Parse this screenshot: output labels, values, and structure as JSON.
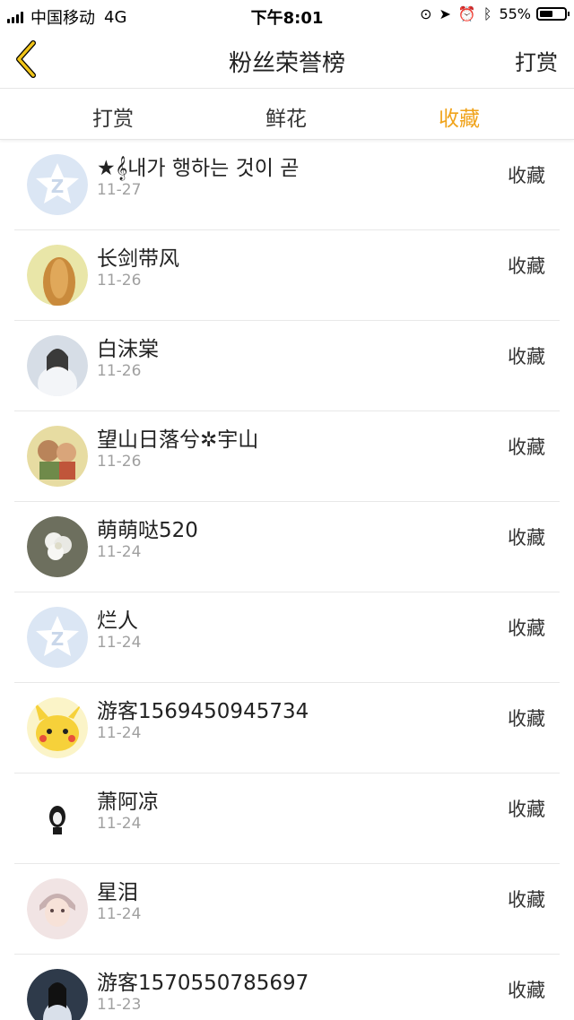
{
  "status_bar": {
    "carrier": "中国移动",
    "network": "4G",
    "time": "下午8:01",
    "battery": "55%",
    "battery_level": 0.55
  },
  "nav": {
    "title": "粉丝荣誉榜",
    "action": "打赏",
    "back_icon": "chevron-left-icon"
  },
  "tabs": [
    {
      "label": "打赏",
      "active": false
    },
    {
      "label": "鲜花",
      "active": false
    },
    {
      "label": "收藏",
      "active": true
    }
  ],
  "accent_color": "#f0a31b",
  "list": [
    {
      "name": "★𝄞내가 행하는 것이 곧",
      "date": "11-27",
      "action": "收藏",
      "avatar": "default-qq-avatar"
    },
    {
      "name": "长剑带风",
      "date": "11-26",
      "action": "收藏",
      "avatar": "photo-avatar"
    },
    {
      "name": "白沫棠",
      "date": "11-26",
      "action": "收藏",
      "avatar": "photo-avatar"
    },
    {
      "name": "望山日落兮✲宇山",
      "date": "11-26",
      "action": "收藏",
      "avatar": "cartoon-avatar"
    },
    {
      "name": "萌萌哒520",
      "date": "11-24",
      "action": "收藏",
      "avatar": "flower-avatar"
    },
    {
      "name": "烂人",
      "date": "11-24",
      "action": "收藏",
      "avatar": "default-qq-avatar"
    },
    {
      "name": "游客1569450945734",
      "date": "11-24",
      "action": "收藏",
      "avatar": "pikachu-avatar"
    },
    {
      "name": "萧阿凉",
      "date": "11-24",
      "action": "收藏",
      "avatar": "drawing-avatar"
    },
    {
      "name": "星泪",
      "date": "11-24",
      "action": "收藏",
      "avatar": "photo-avatar"
    },
    {
      "name": "游客1570550785697",
      "date": "11-23",
      "action": "收藏",
      "avatar": "photo-avatar"
    }
  ]
}
